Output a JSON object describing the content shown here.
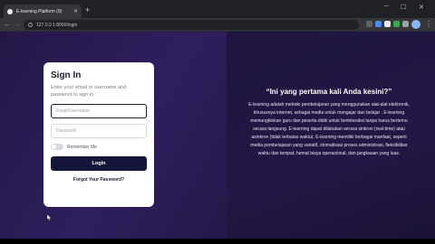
{
  "browser": {
    "tab_title": "E-learning Platform (9)",
    "new_tab_symbol": "+",
    "url": "127.0.0.1:8000/login",
    "controls": {
      "minimize": "─",
      "maximize": "☐",
      "close": "✕"
    }
  },
  "login": {
    "title": "Sign In",
    "subtitle": "Enter your email or username and password to sign in",
    "email_placeholder": "Email/Username",
    "password_placeholder": "Password",
    "remember_label": "Remember Me",
    "login_button": "Login",
    "forgot_link": "Forgot Your Password?"
  },
  "info": {
    "title": "“Ini yang pertama kali Anda kesini?”",
    "body": "E-learning adalah metode pembelajaran yang menggunakan alat-alat elektronik, khususnya internet, sebagai media untuk mengajar dan belajar . E-learning memungkinkan guru dan peserta didik untuk berinteraksi tanpa harus bertemu secara langsung. E-learning dapat dilakukan secara sinkron (real-time) atau asinkron (tidak terbatas waktu). E-learning memiliki berbagai manfaat, seperti media pembelajaran yang variatif, otomatisasi proses administrasi, fleksibilitas waktu dan tempat, hemat biaya operasional, dan jangkauan yang luas."
  },
  "colors": {
    "background": "#2a1b55",
    "button": "#15153a",
    "card": "#ffffff"
  }
}
